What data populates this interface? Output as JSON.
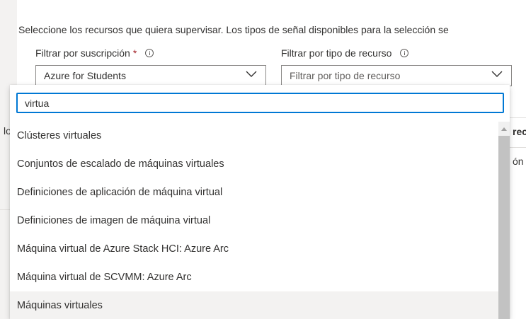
{
  "description": "Seleccione los recursos que quiera supervisar. Los tipos de señal disponibles para la selección se",
  "subscription_filter": {
    "label": "Filtrar por suscripción",
    "required_mark": "*",
    "value": "Azure for Students",
    "icon": "info-icon"
  },
  "resource_type_filter": {
    "label": "Filtrar por tipo de recurso",
    "placeholder": "Filtrar por tipo de recurso",
    "icon": "info-icon"
  },
  "background_fragments": {
    "left_partial": "lo",
    "right_header_partial": "rec",
    "right_cell_partial": "ón"
  },
  "popup": {
    "search_value": "virtua",
    "items": [
      "Clústeres virtuales",
      "Conjuntos de escalado de máquinas virtuales",
      "Definiciones de aplicación de máquina virtual",
      "Definiciones de imagen de máquina virtual",
      "Máquina virtual de Azure Stack HCI: Azure Arc",
      "Máquina virtual de SCVMM: Azure Arc",
      "Máquinas virtuales"
    ],
    "hovered_item": "Máquinas virtuales"
  },
  "colors": {
    "accent": "#0078d4",
    "required": "#a4262c",
    "hover": "#f3f2f1"
  }
}
